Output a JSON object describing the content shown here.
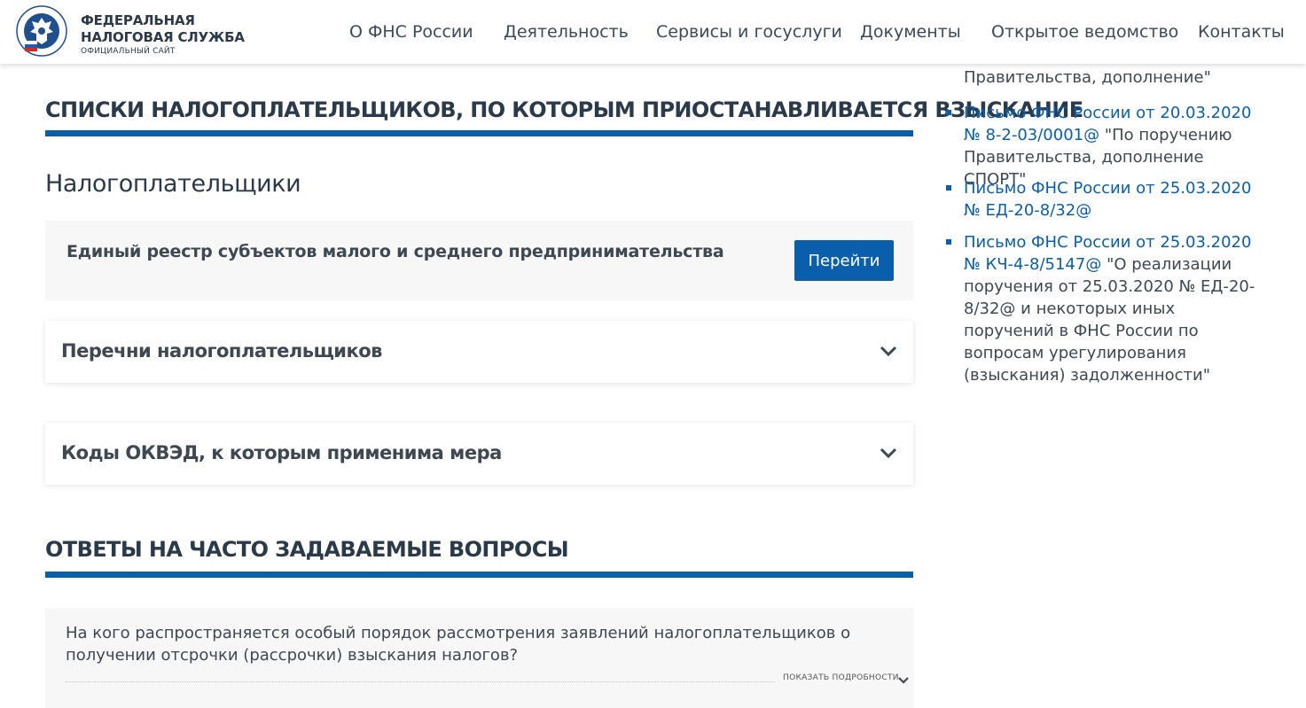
{
  "header": {
    "logo": {
      "line1": "ФЕДЕРАЛЬНАЯ",
      "line2": "НАЛОГОВАЯ СЛУЖБА",
      "line3": "ОФИЦИАЛЬНЫЙ САЙТ",
      "emblem_text": "ФЕДЕРАЛЬНАЯ НАЛОГОВАЯ СЛУЖБА"
    },
    "nav": [
      {
        "label": "О ФНС России"
      },
      {
        "label": "Деятельность"
      },
      {
        "label": "Сервисы и госуслуги"
      },
      {
        "label": "Документы"
      },
      {
        "label": "Открытое ведомство"
      },
      {
        "label": "Контакты"
      }
    ]
  },
  "main": {
    "section_title": "СПИСКИ НАЛОГОПЛАТЕЛЬЩИКОВ, ПО КОТОРЫМ ПРИОСТАНАВЛИВАЕТСЯ ВЗЫСКАНИЕ",
    "subtitle": "Налогоплательщики",
    "registry": {
      "text": "Единый реестр субъектов малого и среднего предпринимательства",
      "button": "Перейти"
    },
    "accordions": [
      {
        "label": "Перечни налогоплательщиков"
      },
      {
        "label": "Коды ОКВЭД, к которым применима мера"
      }
    ],
    "faq_title": "ОТВЕТЫ НА ЧАСТО ЗАДАВАЕМЫЕ ВОПРОСЫ",
    "faq": {
      "question": "На кого распространяется особый порядок рассмотрения заявлений налогоплательщиков о получении отсрочки (рассрочки) взыскания налогов?",
      "more": "ПОКАЗАТЬ ПОДРОБНОСТИ"
    }
  },
  "sidebar": {
    "partial_text": "Правительства, дополнение\"",
    "documents": [
      {
        "link": "Письмо ФНС России от 20.03.2020 № 8-2-03/0001@",
        "tail": " \"По поручению Правительства, дополнение СПОРТ\""
      },
      {
        "link": "Письмо ФНС России от 25.03.2020 № ЕД-20-8/32@",
        "tail": ""
      },
      {
        "link": "Письмо ФНС России от 25.03.2020 № КЧ-4-8/5147@",
        "tail": " \"О реализации поручения от 25.03.2020 № ЕД-20-8/32@ и некоторых иных поручений в ФНС России по вопросам урегулирования (взыскания) задолженности\""
      }
    ]
  },
  "colors": {
    "brand_blue": "#0a5fad",
    "heading": "#2b3a4a",
    "card_bg": "#f7f7f7"
  },
  "icons": {
    "logo": "fns-emblem-icon",
    "accordion": "chevron-down-icon"
  }
}
